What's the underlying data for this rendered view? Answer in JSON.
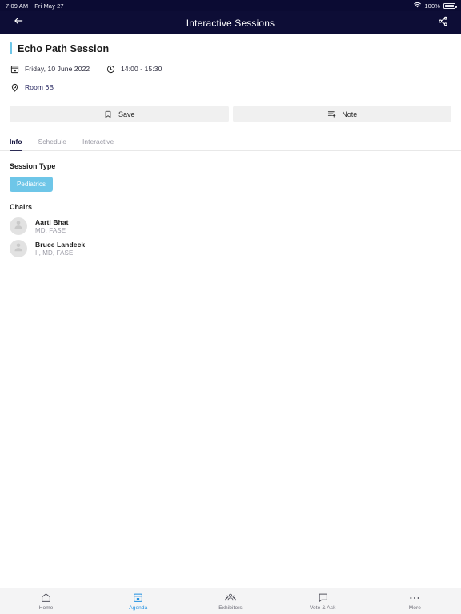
{
  "status_bar": {
    "time": "7:09 AM",
    "date": "Fri May 27",
    "battery_percent": "100%",
    "wifi_icon": "wifi-icon",
    "battery_icon": "battery-full-icon"
  },
  "header": {
    "title": "Interactive Sessions",
    "back_icon": "back-arrow-icon",
    "share_icon": "share-icon",
    "background": "#0d0d36"
  },
  "session": {
    "title": "Echo Path Session",
    "accent_color": "#6ec6e8",
    "date": "Friday, 10 June 2022",
    "time": "14:00 - 15:30",
    "room": "Room 6B",
    "calendar_icon": "calendar-icon",
    "clock_icon": "clock-icon",
    "location_icon": "location-pin-icon"
  },
  "actions": {
    "save_label": "Save",
    "save_icon": "bookmark-icon",
    "note_label": "Note",
    "note_icon": "note-add-icon"
  },
  "tabs": [
    {
      "label": "Info",
      "active": true
    },
    {
      "label": "Schedule",
      "active": false
    },
    {
      "label": "Interactive",
      "active": false
    }
  ],
  "session_type": {
    "heading": "Session Type",
    "chips": [
      {
        "label": "Pediatrics",
        "color": "#6ec6e8"
      }
    ]
  },
  "chairs": {
    "heading": "Chairs",
    "people": [
      {
        "name": "Aarti Bhat",
        "role": "MD, FASE",
        "avatar_icon": "person-avatar-icon"
      },
      {
        "name": "Bruce Landeck",
        "role": "II, MD, FASE",
        "avatar_icon": "person-avatar-icon"
      }
    ]
  },
  "bottom_nav": {
    "active_color": "#1e8fe1",
    "items": [
      {
        "label": "Home",
        "icon": "home-icon",
        "active": false
      },
      {
        "label": "Agenda",
        "icon": "calendar-icon",
        "active": true
      },
      {
        "label": "Exhibitors",
        "icon": "exhibitors-people-icon",
        "active": false
      },
      {
        "label": "Vote & Ask",
        "icon": "chat-bubble-icon",
        "active": false
      },
      {
        "label": "More",
        "icon": "ellipsis-icon",
        "active": false
      }
    ]
  }
}
